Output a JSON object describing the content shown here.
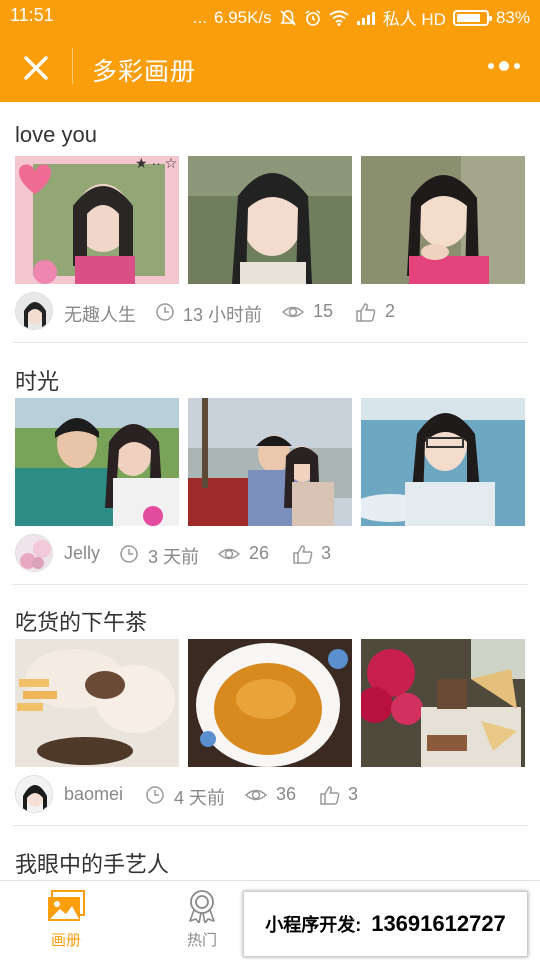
{
  "status_bar": {
    "time": "11:51",
    "dots": "...",
    "speed": "6.95K/s",
    "carrier": "私人 HD",
    "battery": "83%",
    "battery_level": 0.83
  },
  "header": {
    "title": "多彩画册",
    "accent_color": "#fb9e0c"
  },
  "albums": [
    {
      "title": "love you",
      "user": "无趣人生",
      "time": "13 小时前",
      "views": "15",
      "likes": "2"
    },
    {
      "title": "时光",
      "user": "Jelly",
      "time": "3 天前",
      "views": "26",
      "likes": "3"
    },
    {
      "title": "吃货的下午茶",
      "user": "baomei",
      "time": "4 天前",
      "views": "36",
      "likes": "3"
    },
    {
      "title": "我眼中的手艺人"
    }
  ],
  "tabbar": {
    "albums_label": "画册",
    "hot_label": "热门",
    "promo_label": "小程序开发:",
    "promo_phone": "13691612727"
  }
}
